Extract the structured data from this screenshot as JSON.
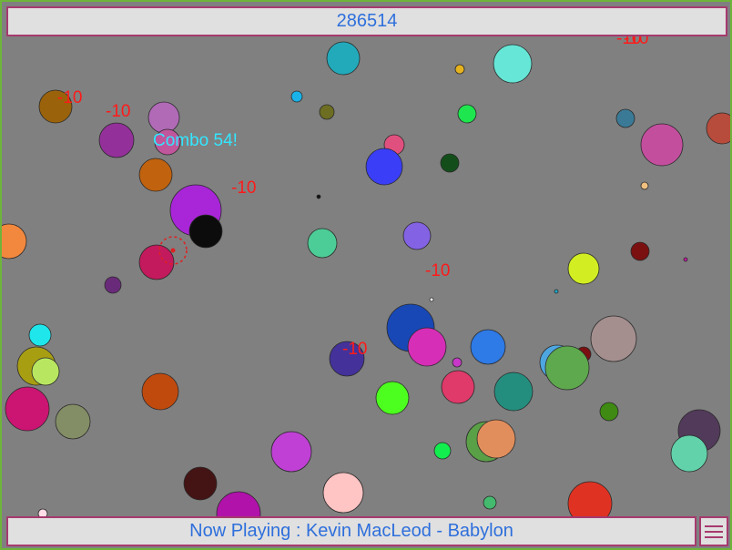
{
  "score": "286514",
  "now_playing": "Now Playing : Kevin MacLeod - Babylon",
  "combo": "Combo 54!",
  "penalty_label": "-10",
  "menu_icon": "hamburger-menu-icon",
  "colors": {
    "background": "#808080",
    "bar": "#e0e0e0",
    "bar_border": "#a63a6e",
    "text": "#2e6fdc",
    "frame": "#6fb43a",
    "popup": "#ff1a1a",
    "combo": "#33e6ff"
  }
}
